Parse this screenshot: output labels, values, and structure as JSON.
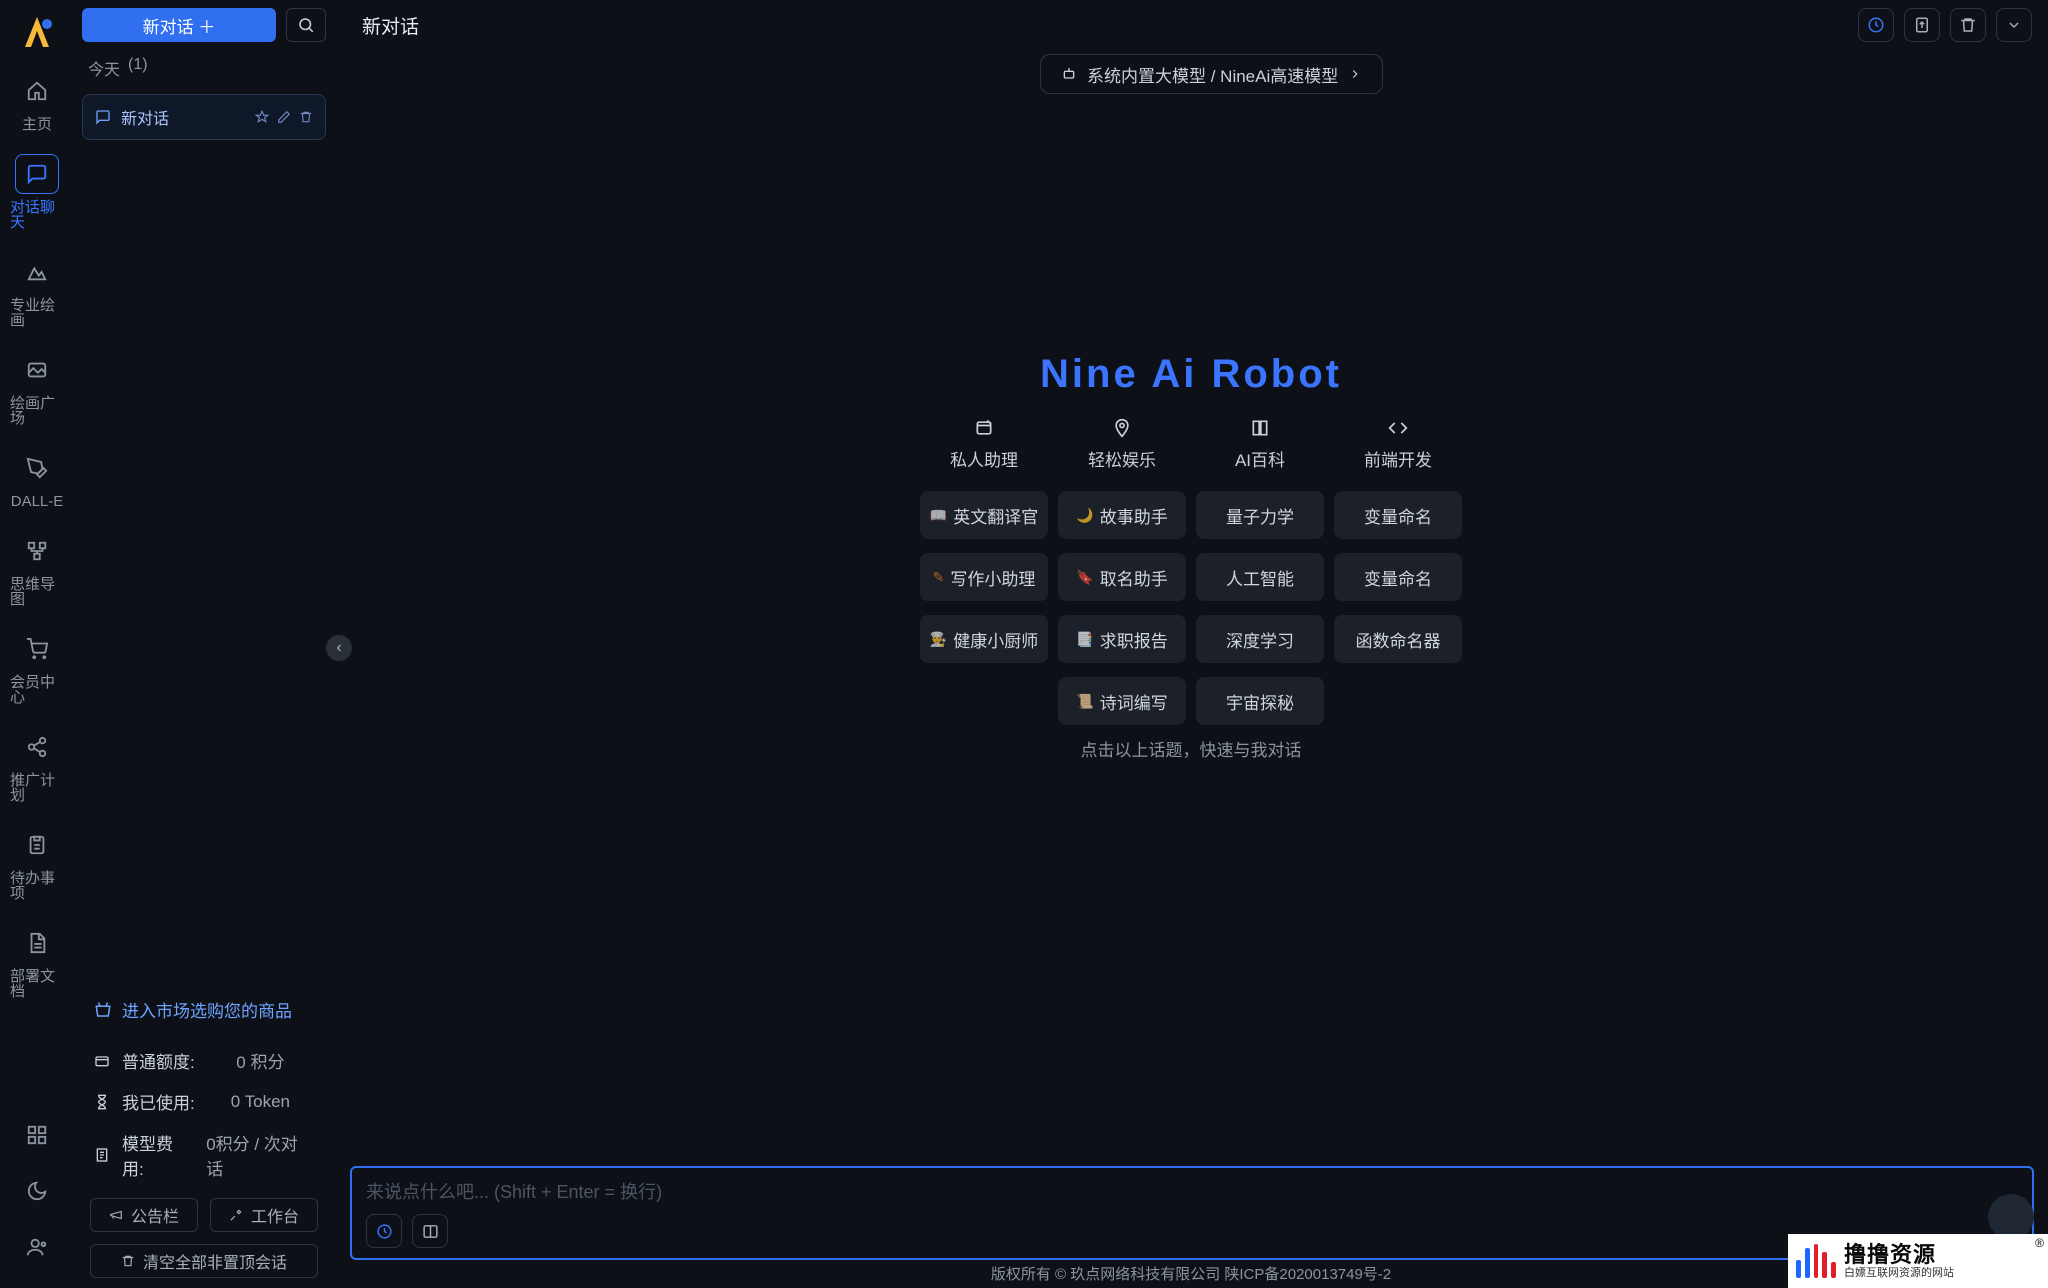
{
  "rail": {
    "items": [
      {
        "label": "主页"
      },
      {
        "label": "对话聊天"
      },
      {
        "label": "专业绘画"
      },
      {
        "label": "绘画广场"
      },
      {
        "label": "DALL-E"
      },
      {
        "label": "思维导图"
      },
      {
        "label": "会员中心"
      },
      {
        "label": "推广计划"
      },
      {
        "label": "待办事项"
      },
      {
        "label": "部署文档"
      }
    ]
  },
  "sidebar": {
    "new_chat_button": "新对话 ＋",
    "group_today": "今天",
    "group_count": "(1)",
    "conversation": {
      "title": "新对话"
    },
    "shop_link": "进入市场选购您的商品",
    "stats": [
      {
        "label": "普通额度:",
        "value": "0 积分"
      },
      {
        "label": "我已使用:",
        "value": "0 Token"
      },
      {
        "label": "模型费用:",
        "value": "0积分 / 次对话"
      }
    ],
    "btn_bulletin": "公告栏",
    "btn_workbench": "工作台",
    "btn_clear": "清空全部非置顶会话"
  },
  "header": {
    "title": "新对话"
  },
  "model_pill": "系统内置大模型 / NineAi高速模型",
  "hero": {
    "title": "Nine Ai Robot",
    "columns": [
      {
        "name": "私人助理",
        "chips": [
          "英文翻译官",
          "写作小助理",
          "健康小厨师"
        ]
      },
      {
        "name": "轻松娱乐",
        "chips": [
          "故事助手",
          "取名助手",
          "求职报告",
          "诗词编写"
        ]
      },
      {
        "name": "AI百科",
        "chips": [
          "量子力学",
          "人工智能",
          "深度学习",
          "宇宙探秘"
        ]
      },
      {
        "name": "前端开发",
        "chips": [
          "变量命名",
          "变量命名",
          "函数命名器"
        ]
      }
    ],
    "hint": "点击以上话题，快速与我对话"
  },
  "composer": {
    "placeholder": "来说点什么吧... (Shift + Enter = 换行)",
    "value": ""
  },
  "footer": "版权所有 © 玖点网络科技有限公司  陕ICP备2020013749号-2",
  "watermark": {
    "big": "撸撸资源",
    "small": "白嫖互联网资源的网站"
  }
}
